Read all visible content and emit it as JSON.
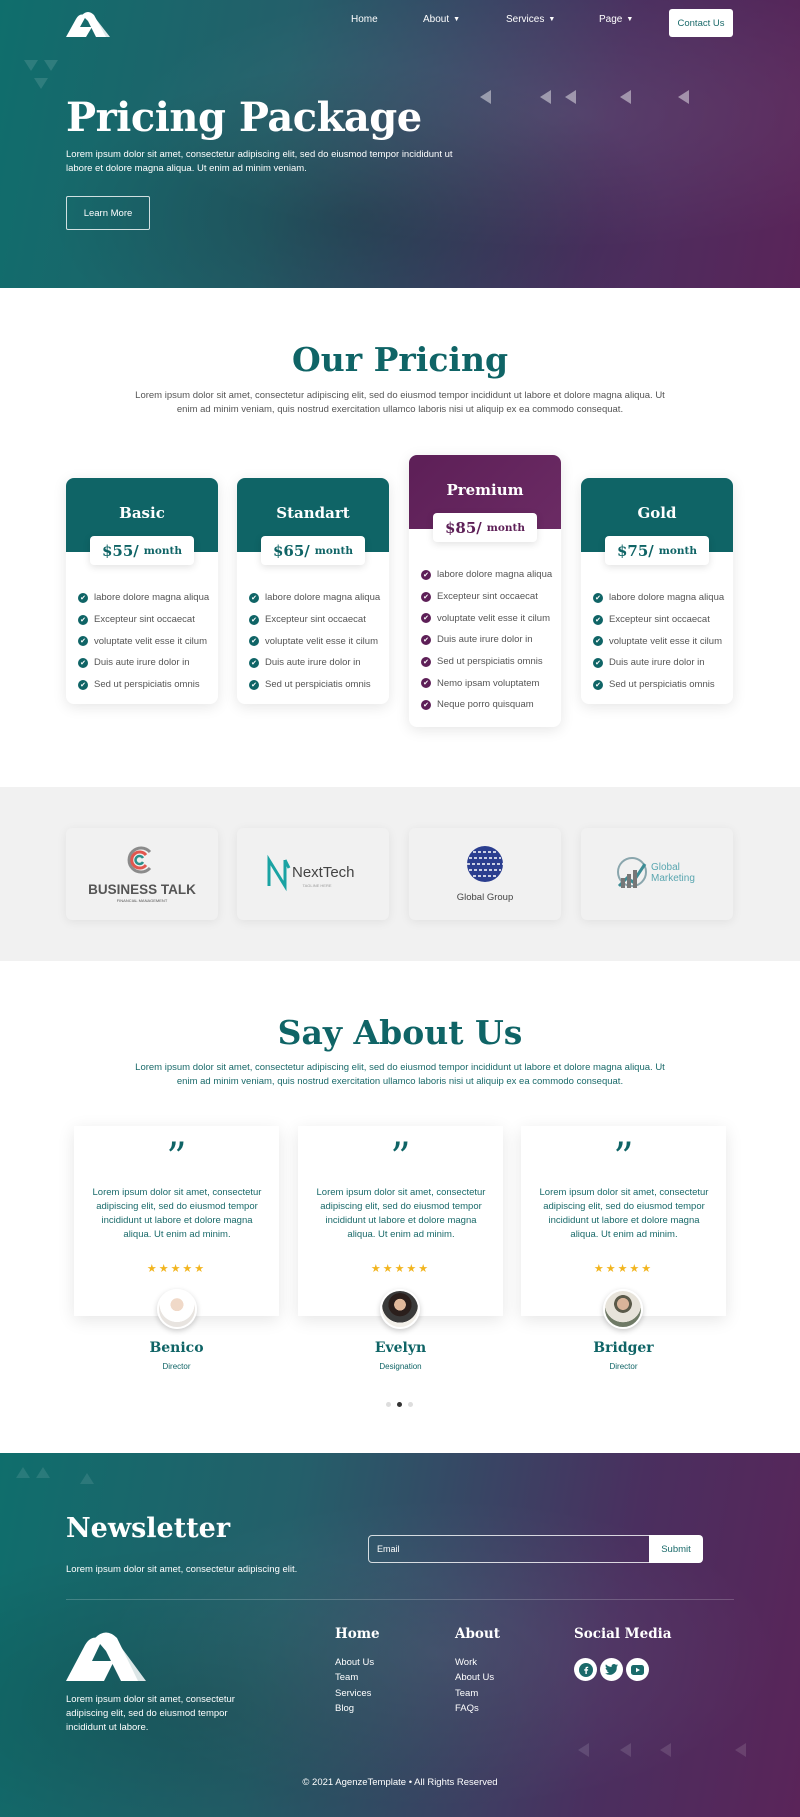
{
  "nav": {
    "items": [
      {
        "label": "Home",
        "dropdown": false
      },
      {
        "label": "About",
        "dropdown": true
      },
      {
        "label": "Services",
        "dropdown": true
      },
      {
        "label": "Page",
        "dropdown": true
      }
    ],
    "contact_label": "Contact Us"
  },
  "hero": {
    "title": "Pricing Package",
    "text": "Lorem ipsum dolor sit amet, consectetur adipiscing elit, sed do eiusmod tempor incididunt ut labore et dolore magna aliqua. Ut enim ad minim veniam.",
    "button_label": "Learn More"
  },
  "pricing": {
    "title": "Our Pricing",
    "text": "Lorem ipsum dolor sit amet, consectetur adipiscing elit, sed do eiusmod tempor incididunt ut labore et dolore magna aliqua. Ut enim ad minim veniam, quis nostrud exercitation ullamco laboris nisi ut aliquip ex ea commodo consequat.",
    "plans": [
      {
        "name": "Basic",
        "price": "$55/",
        "period": "month",
        "featured": false,
        "features": [
          "labore dolore magna aliqua",
          "Excepteur sint occaecat",
          "voluptate velit esse it cilum",
          "Duis aute irure dolor in",
          "Sed ut perspiciatis omnis"
        ]
      },
      {
        "name": "Standart",
        "price": "$65/",
        "period": "month",
        "featured": false,
        "features": [
          "labore dolore magna aliqua",
          "Excepteur sint occaecat",
          "voluptate velit esse it cilum",
          "Duis aute irure dolor in",
          "Sed ut perspiciatis omnis"
        ]
      },
      {
        "name": "Premium",
        "price": "$85/",
        "period": "month",
        "featured": true,
        "features": [
          "labore dolore magna aliqua",
          "Excepteur sint occaecat",
          "voluptate velit esse it cilum",
          "Duis aute irure dolor in",
          "Sed ut perspiciatis omnis",
          "Nemo ipsam voluptatem",
          "Neque porro quisquam"
        ]
      },
      {
        "name": "Gold",
        "price": "$75/",
        "period": "month",
        "featured": false,
        "features": [
          "labore dolore magna aliqua",
          "Excepteur sint occaecat",
          "voluptate velit esse it cilum",
          "Duis aute irure dolor in",
          "Sed ut perspiciatis omnis"
        ]
      }
    ]
  },
  "partners": [
    {
      "name": "BUSINESS TALK",
      "tagline": "FINANCIAL MANAGEMENT"
    },
    {
      "name": "NextTech",
      "tagline": "TAGLINE HERE"
    },
    {
      "name": "Global Group"
    },
    {
      "name": "Global Marketing"
    }
  ],
  "testimonials": {
    "title": "Say About Us",
    "text": "Lorem ipsum dolor sit amet, consectetur adipiscing elit, sed do eiusmod tempor incididunt ut labore et dolore magna aliqua. Ut enim ad minim veniam, quis nostrud exercitation ullamco laboris nisi ut aliquip ex ea commodo consequat.",
    "items": [
      {
        "quote": "Lorem ipsum dolor sit amet, consectetur adipiscing elit, sed do eiusmod tempor incididunt ut labore et dolore magna aliqua. Ut enim ad minim.",
        "stars": "★★★★★",
        "name": "Benico",
        "role": "Director"
      },
      {
        "quote": "Lorem ipsum dolor sit amet, consectetur adipiscing elit, sed do eiusmod tempor incididunt ut labore et dolore magna aliqua. Ut enim ad minim.",
        "stars": "★★★★★",
        "name": "Evelyn",
        "role": "Designation"
      },
      {
        "quote": "Lorem ipsum dolor sit amet, consectetur adipiscing elit, sed do eiusmod tempor incididunt ut labore et dolore magna aliqua. Ut enim ad minim.",
        "stars": "★★★★★",
        "name": "Bridger",
        "role": "Director"
      }
    ],
    "rating": 5,
    "active_slide": 2,
    "slide_count": 3
  },
  "newsletter": {
    "title": "Newsletter",
    "text": "Lorem ipsum dolor sit amet, consectetur adipiscing elit.",
    "email_placeholder": "Email",
    "submit_label": "Submit"
  },
  "footer": {
    "about": "Lorem ipsum dolor sit amet, consectetur adipiscing elit, sed do eiusmod tempor incididunt ut labore.",
    "columns": [
      {
        "title": "Home",
        "links": [
          "About Us",
          "Team",
          "Services",
          "Blog"
        ]
      },
      {
        "title": "About",
        "links": [
          "Work",
          "About Us",
          "Team",
          "FAQs"
        ]
      }
    ],
    "social_title": "Social Media",
    "social": [
      "facebook-icon",
      "twitter-icon",
      "youtube-icon"
    ],
    "copyright": "© 2021 AgenzeTemplate • All Rights Reserved"
  },
  "colors": {
    "teal": "#0f6466",
    "purple": "#5d1f57",
    "star": "#f2b51f"
  }
}
